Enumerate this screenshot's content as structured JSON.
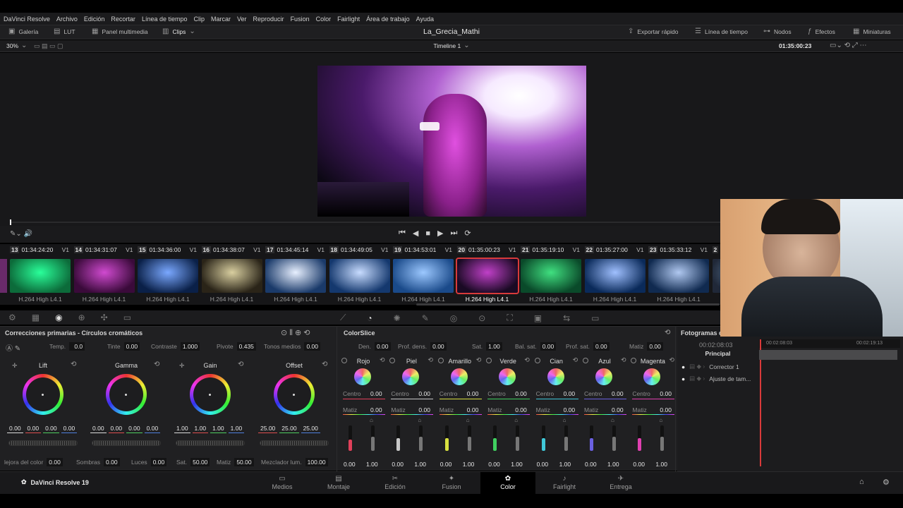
{
  "menu": [
    "DaVinci Resolve",
    "Archivo",
    "Edición",
    "Recortar",
    "Línea de tiempo",
    "Clip",
    "Marcar",
    "Ver",
    "Reproducir",
    "Fusion",
    "Color",
    "Fairlight",
    "Área de trabajo",
    "Ayuda"
  ],
  "toolbar": {
    "left": [
      "Galería",
      "LUT",
      "Panel multimedia",
      "Clips"
    ],
    "project_title": "La_Grecia_Mathi",
    "right": [
      "Exportar rápido",
      "Línea de tiempo",
      "Nodos",
      "Efectos",
      "Miniaturas"
    ]
  },
  "viewerbar": {
    "zoom": "30%",
    "timeline": "Timeline 1",
    "timecode": "01:35:00:23"
  },
  "clips": [
    {
      "num": "13",
      "tc": "01:34:24:20",
      "track": "V1",
      "codec": "H.264 High L4.1",
      "c1": "#0c6b3a",
      "c2": "#2aff9a"
    },
    {
      "num": "14",
      "tc": "01:34:31:07",
      "track": "V1",
      "codec": "H.264 High L4.1",
      "c1": "#3a0a3a",
      "c2": "#d04ad0"
    },
    {
      "num": "15",
      "tc": "01:34:36:00",
      "track": "V1",
      "codec": "H.264 High L4.1",
      "c1": "#0a2048",
      "c2": "#7aa8ff"
    },
    {
      "num": "16",
      "tc": "01:34:38:07",
      "track": "V1",
      "codec": "H.264 High L4.1",
      "c1": "#2a2418",
      "c2": "#d9cfa0"
    },
    {
      "num": "17",
      "tc": "01:34:45:14",
      "track": "V1",
      "codec": "H.264 High L4.1",
      "c1": "#1a3a6a",
      "c2": "#e8f0ff"
    },
    {
      "num": "18",
      "tc": "01:34:49:05",
      "track": "V1",
      "codec": "H.264 High L4.1",
      "c1": "#14386e",
      "c2": "#c8dcff"
    },
    {
      "num": "19",
      "tc": "01:34:53:01",
      "track": "V1",
      "codec": "H.264 High L4.1",
      "c1": "#1a4a8a",
      "c2": "#9cc8ff"
    },
    {
      "num": "20",
      "tc": "01:35:00:23",
      "track": "V1",
      "codec": "H.264 High L4.1",
      "c1": "#1a0a24",
      "c2": "#c040c8",
      "selected": true
    },
    {
      "num": "21",
      "tc": "01:35:19:10",
      "track": "V1",
      "codec": "H.264 High L4.1",
      "c1": "#0a4a2a",
      "c2": "#40e080"
    },
    {
      "num": "22",
      "tc": "01:35:27:00",
      "track": "V1",
      "codec": "H.264 High L4.1",
      "c1": "#0a2a5a",
      "c2": "#a0c0ff"
    },
    {
      "num": "23",
      "tc": "01:35:33:12",
      "track": "V1",
      "codec": "H.264 High L4.1",
      "c1": "#102a50",
      "c2": "#b0c8f0"
    },
    {
      "num": "2",
      "tc": "",
      "track": "",
      "codec": "H.2",
      "c1": "#202838",
      "c2": "#6080a0"
    }
  ],
  "primaries": {
    "title": "Correcciones primarias - Círculos cromáticos",
    "top": [
      {
        "label": "Temp.",
        "value": "0.0"
      },
      {
        "label": "Tinte",
        "value": "0.00"
      },
      {
        "label": "Contraste",
        "value": "1.000"
      },
      {
        "label": "Pivote",
        "value": "0.435"
      },
      {
        "label": "Tonos medios",
        "value": "0.00"
      }
    ],
    "wheels": [
      {
        "name": "Lift",
        "values": [
          "0.00",
          "0.00",
          "0.00",
          "0.00"
        ]
      },
      {
        "name": "Gamma",
        "values": [
          "0.00",
          "0.00",
          "0.00",
          "0.00"
        ]
      },
      {
        "name": "Gain",
        "values": [
          "1.00",
          "1.00",
          "1.00",
          "1.00"
        ]
      },
      {
        "name": "Offset",
        "values": [
          "25.00",
          "25.00",
          "25.00"
        ]
      }
    ],
    "bottom": [
      {
        "label": "lejora del color",
        "value": "0.00"
      },
      {
        "label": "Sombras",
        "value": "0.00"
      },
      {
        "label": "Luces",
        "value": "0.00"
      },
      {
        "label": "Sat.",
        "value": "50.00"
      },
      {
        "label": "Matiz",
        "value": "50.00"
      },
      {
        "label": "Mezclador lum.",
        "value": "100.00"
      }
    ]
  },
  "colorslice": {
    "title": "ColorSlice",
    "top": [
      {
        "label": "Den.",
        "value": "0.00"
      },
      {
        "label": "Prof. dens.",
        "value": "0.00"
      },
      {
        "label": "Sat.",
        "value": "1.00"
      },
      {
        "label": "Bal. sat.",
        "value": "0.00"
      },
      {
        "label": "Prof. sat.",
        "value": "0.00"
      },
      {
        "label": "Matiz",
        "value": "0.00"
      }
    ],
    "center_label": "Centro",
    "hue_label": "Matiz",
    "slices": [
      {
        "name": "Rojo",
        "centro": "0.00",
        "matiz": "0.00",
        "low": "0.00",
        "high": "1.00",
        "color": "#e0405a",
        "lvl": 0.45
      },
      {
        "name": "Piel",
        "centro": "0.00",
        "matiz": "0.00",
        "low": "0.00",
        "high": "1.00",
        "color": "#c8c8c8",
        "lvl": 0.5
      },
      {
        "name": "Amarillo",
        "centro": "0.00",
        "matiz": "0.00",
        "low": "0.00",
        "high": "1.00",
        "color": "#d8e040",
        "lvl": 0.5
      },
      {
        "name": "Verde",
        "centro": "0.00",
        "matiz": "0.00",
        "low": "0.00",
        "high": "1.00",
        "color": "#40d060",
        "lvl": 0.5
      },
      {
        "name": "Cian",
        "centro": "0.00",
        "matiz": "0.00",
        "low": "0.00",
        "high": "1.00",
        "color": "#40c8d8",
        "lvl": 0.5
      },
      {
        "name": "Azul",
        "centro": "0.00",
        "matiz": "0.00",
        "low": "0.00",
        "high": "1.00",
        "color": "#6a60e0",
        "lvl": 0.5
      },
      {
        "name": "Magenta",
        "centro": "0.00",
        "matiz": "0.00",
        "low": "0.00",
        "high": "1.00",
        "color": "#e040b0",
        "lvl": 0.5
      }
    ]
  },
  "keyframes": {
    "title": "Fotogramas c",
    "tc_left": "00:02:08:03",
    "tc_ruler": "00:02:08:03",
    "tc_ruler2": "00:02:19:13",
    "rows": [
      "Principal",
      "Corrector 1",
      "Ajuste de tam..."
    ]
  },
  "bottombar": {
    "brand": "DaVinci Resolve 19",
    "tabs": [
      "Medios",
      "Montaje",
      "Edición",
      "Fusion",
      "Color",
      "Fairlight",
      "Entrega"
    ],
    "active": "Color"
  },
  "colors": {
    "accent": "#d83a3a",
    "panel": "#202022"
  }
}
